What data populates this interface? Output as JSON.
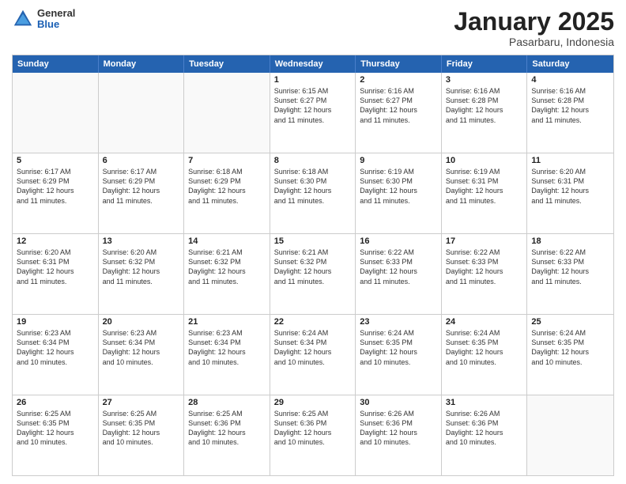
{
  "header": {
    "logo": {
      "general": "General",
      "blue": "Blue"
    },
    "title": "January 2025",
    "location": "Pasarbaru, Indonesia"
  },
  "days": [
    "Sunday",
    "Monday",
    "Tuesday",
    "Wednesday",
    "Thursday",
    "Friday",
    "Saturday"
  ],
  "weeks": [
    [
      {
        "day": "",
        "text": ""
      },
      {
        "day": "",
        "text": ""
      },
      {
        "day": "",
        "text": ""
      },
      {
        "day": "1",
        "text": "Sunrise: 6:15 AM\nSunset: 6:27 PM\nDaylight: 12 hours\nand 11 minutes."
      },
      {
        "day": "2",
        "text": "Sunrise: 6:16 AM\nSunset: 6:27 PM\nDaylight: 12 hours\nand 11 minutes."
      },
      {
        "day": "3",
        "text": "Sunrise: 6:16 AM\nSunset: 6:28 PM\nDaylight: 12 hours\nand 11 minutes."
      },
      {
        "day": "4",
        "text": "Sunrise: 6:16 AM\nSunset: 6:28 PM\nDaylight: 12 hours\nand 11 minutes."
      }
    ],
    [
      {
        "day": "5",
        "text": "Sunrise: 6:17 AM\nSunset: 6:29 PM\nDaylight: 12 hours\nand 11 minutes."
      },
      {
        "day": "6",
        "text": "Sunrise: 6:17 AM\nSunset: 6:29 PM\nDaylight: 12 hours\nand 11 minutes."
      },
      {
        "day": "7",
        "text": "Sunrise: 6:18 AM\nSunset: 6:29 PM\nDaylight: 12 hours\nand 11 minutes."
      },
      {
        "day": "8",
        "text": "Sunrise: 6:18 AM\nSunset: 6:30 PM\nDaylight: 12 hours\nand 11 minutes."
      },
      {
        "day": "9",
        "text": "Sunrise: 6:19 AM\nSunset: 6:30 PM\nDaylight: 12 hours\nand 11 minutes."
      },
      {
        "day": "10",
        "text": "Sunrise: 6:19 AM\nSunset: 6:31 PM\nDaylight: 12 hours\nand 11 minutes."
      },
      {
        "day": "11",
        "text": "Sunrise: 6:20 AM\nSunset: 6:31 PM\nDaylight: 12 hours\nand 11 minutes."
      }
    ],
    [
      {
        "day": "12",
        "text": "Sunrise: 6:20 AM\nSunset: 6:31 PM\nDaylight: 12 hours\nand 11 minutes."
      },
      {
        "day": "13",
        "text": "Sunrise: 6:20 AM\nSunset: 6:32 PM\nDaylight: 12 hours\nand 11 minutes."
      },
      {
        "day": "14",
        "text": "Sunrise: 6:21 AM\nSunset: 6:32 PM\nDaylight: 12 hours\nand 11 minutes."
      },
      {
        "day": "15",
        "text": "Sunrise: 6:21 AM\nSunset: 6:32 PM\nDaylight: 12 hours\nand 11 minutes."
      },
      {
        "day": "16",
        "text": "Sunrise: 6:22 AM\nSunset: 6:33 PM\nDaylight: 12 hours\nand 11 minutes."
      },
      {
        "day": "17",
        "text": "Sunrise: 6:22 AM\nSunset: 6:33 PM\nDaylight: 12 hours\nand 11 minutes."
      },
      {
        "day": "18",
        "text": "Sunrise: 6:22 AM\nSunset: 6:33 PM\nDaylight: 12 hours\nand 11 minutes."
      }
    ],
    [
      {
        "day": "19",
        "text": "Sunrise: 6:23 AM\nSunset: 6:34 PM\nDaylight: 12 hours\nand 10 minutes."
      },
      {
        "day": "20",
        "text": "Sunrise: 6:23 AM\nSunset: 6:34 PM\nDaylight: 12 hours\nand 10 minutes."
      },
      {
        "day": "21",
        "text": "Sunrise: 6:23 AM\nSunset: 6:34 PM\nDaylight: 12 hours\nand 10 minutes."
      },
      {
        "day": "22",
        "text": "Sunrise: 6:24 AM\nSunset: 6:34 PM\nDaylight: 12 hours\nand 10 minutes."
      },
      {
        "day": "23",
        "text": "Sunrise: 6:24 AM\nSunset: 6:35 PM\nDaylight: 12 hours\nand 10 minutes."
      },
      {
        "day": "24",
        "text": "Sunrise: 6:24 AM\nSunset: 6:35 PM\nDaylight: 12 hours\nand 10 minutes."
      },
      {
        "day": "25",
        "text": "Sunrise: 6:24 AM\nSunset: 6:35 PM\nDaylight: 12 hours\nand 10 minutes."
      }
    ],
    [
      {
        "day": "26",
        "text": "Sunrise: 6:25 AM\nSunset: 6:35 PM\nDaylight: 12 hours\nand 10 minutes."
      },
      {
        "day": "27",
        "text": "Sunrise: 6:25 AM\nSunset: 6:35 PM\nDaylight: 12 hours\nand 10 minutes."
      },
      {
        "day": "28",
        "text": "Sunrise: 6:25 AM\nSunset: 6:36 PM\nDaylight: 12 hours\nand 10 minutes."
      },
      {
        "day": "29",
        "text": "Sunrise: 6:25 AM\nSunset: 6:36 PM\nDaylight: 12 hours\nand 10 minutes."
      },
      {
        "day": "30",
        "text": "Sunrise: 6:26 AM\nSunset: 6:36 PM\nDaylight: 12 hours\nand 10 minutes."
      },
      {
        "day": "31",
        "text": "Sunrise: 6:26 AM\nSunset: 6:36 PM\nDaylight: 12 hours\nand 10 minutes."
      },
      {
        "day": "",
        "text": ""
      }
    ]
  ]
}
